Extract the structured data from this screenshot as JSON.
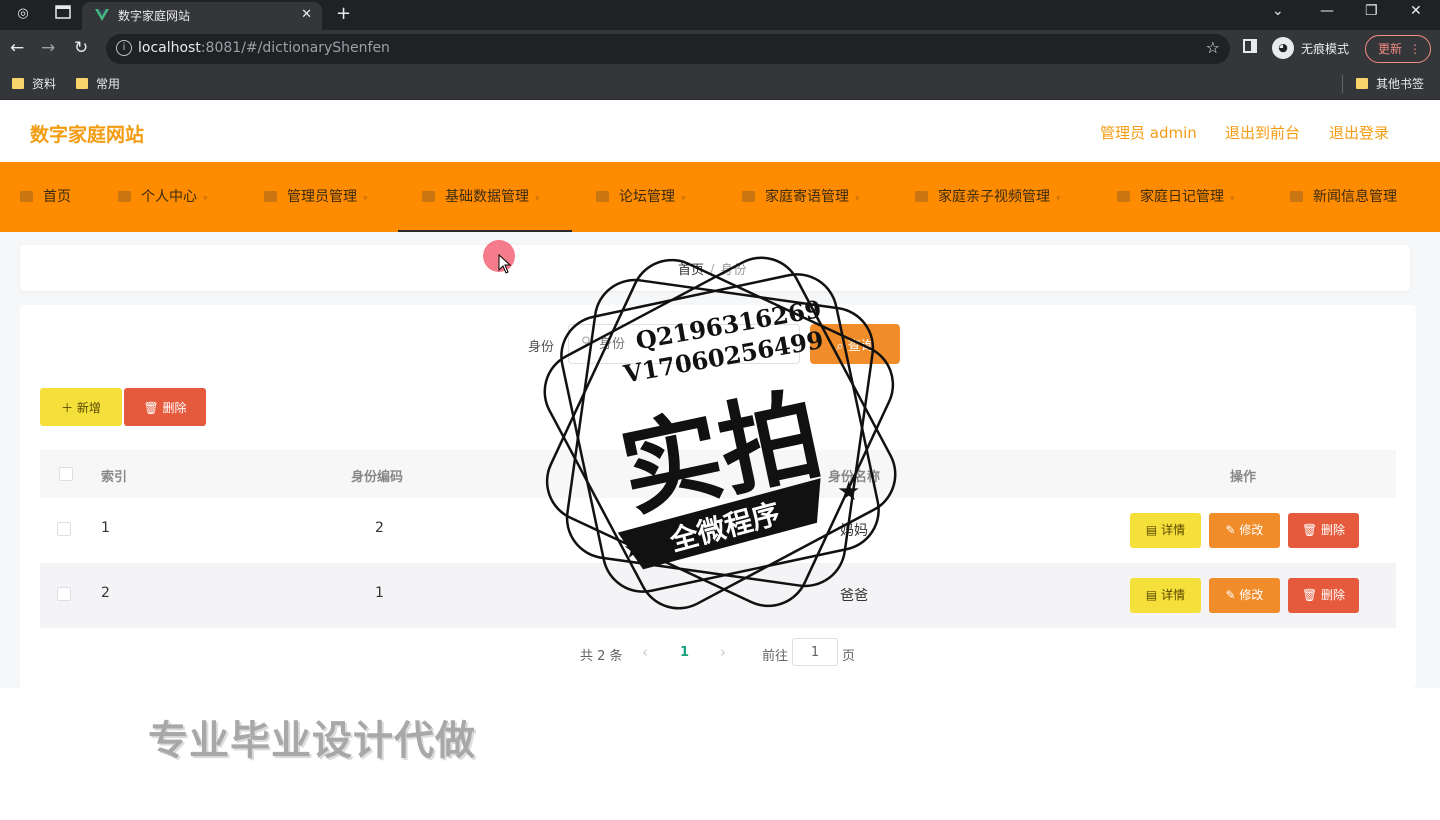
{
  "browser": {
    "tab_title": "数字家庭网站",
    "url_host": "localhost",
    "url_rest": ":8081/#/dictionaryShenfen",
    "incognito_label": "无痕模式",
    "update_label": "更新",
    "bookmarks": [
      "资料",
      "常用"
    ],
    "other_bookmarks": "其他书签"
  },
  "header": {
    "site_title": "数字家庭网站",
    "admin_label": "管理员 admin",
    "front_label": "退出到前台",
    "logout_label": "退出登录"
  },
  "nav": {
    "items": [
      {
        "label": "首页"
      },
      {
        "label": "个人中心"
      },
      {
        "label": "管理员管理"
      },
      {
        "label": "基础数据管理"
      },
      {
        "label": "论坛管理"
      },
      {
        "label": "家庭寄语管理"
      },
      {
        "label": "家庭亲子视频管理"
      },
      {
        "label": "家庭日记管理"
      },
      {
        "label": "新闻信息管理"
      }
    ]
  },
  "breadcrumb": {
    "home": "首页",
    "current": "身份"
  },
  "search": {
    "label": "身份",
    "placeholder": "身份",
    "button_label": "查询"
  },
  "toolbar": {
    "add_label": "新增",
    "delete_label": "删除"
  },
  "table": {
    "headers": {
      "index": "索引",
      "code": "身份编码",
      "name": "身份名称",
      "actions": "操作"
    },
    "rows": [
      {
        "index": "1",
        "code": "2",
        "name": "妈妈"
      },
      {
        "index": "2",
        "code": "1",
        "name": "爸爸"
      }
    ],
    "actions": {
      "detail": "详情",
      "edit": "修改",
      "delete": "删除"
    }
  },
  "pagination": {
    "total": "共 2 条",
    "current_page": "1",
    "goto_label": "前往",
    "page_value": "1",
    "page_suffix": "页"
  },
  "overlay": {
    "stamp_line1": "Q2196316269",
    "stamp_line2": "V17060256499",
    "stamp_big": "实拍",
    "stamp_banner": "全微程序",
    "caption": "专业毕业设计代做"
  },
  "colors": {
    "accent": "#ff8c00",
    "title_orange": "#f39c12",
    "active_page": "#1aa17f"
  }
}
